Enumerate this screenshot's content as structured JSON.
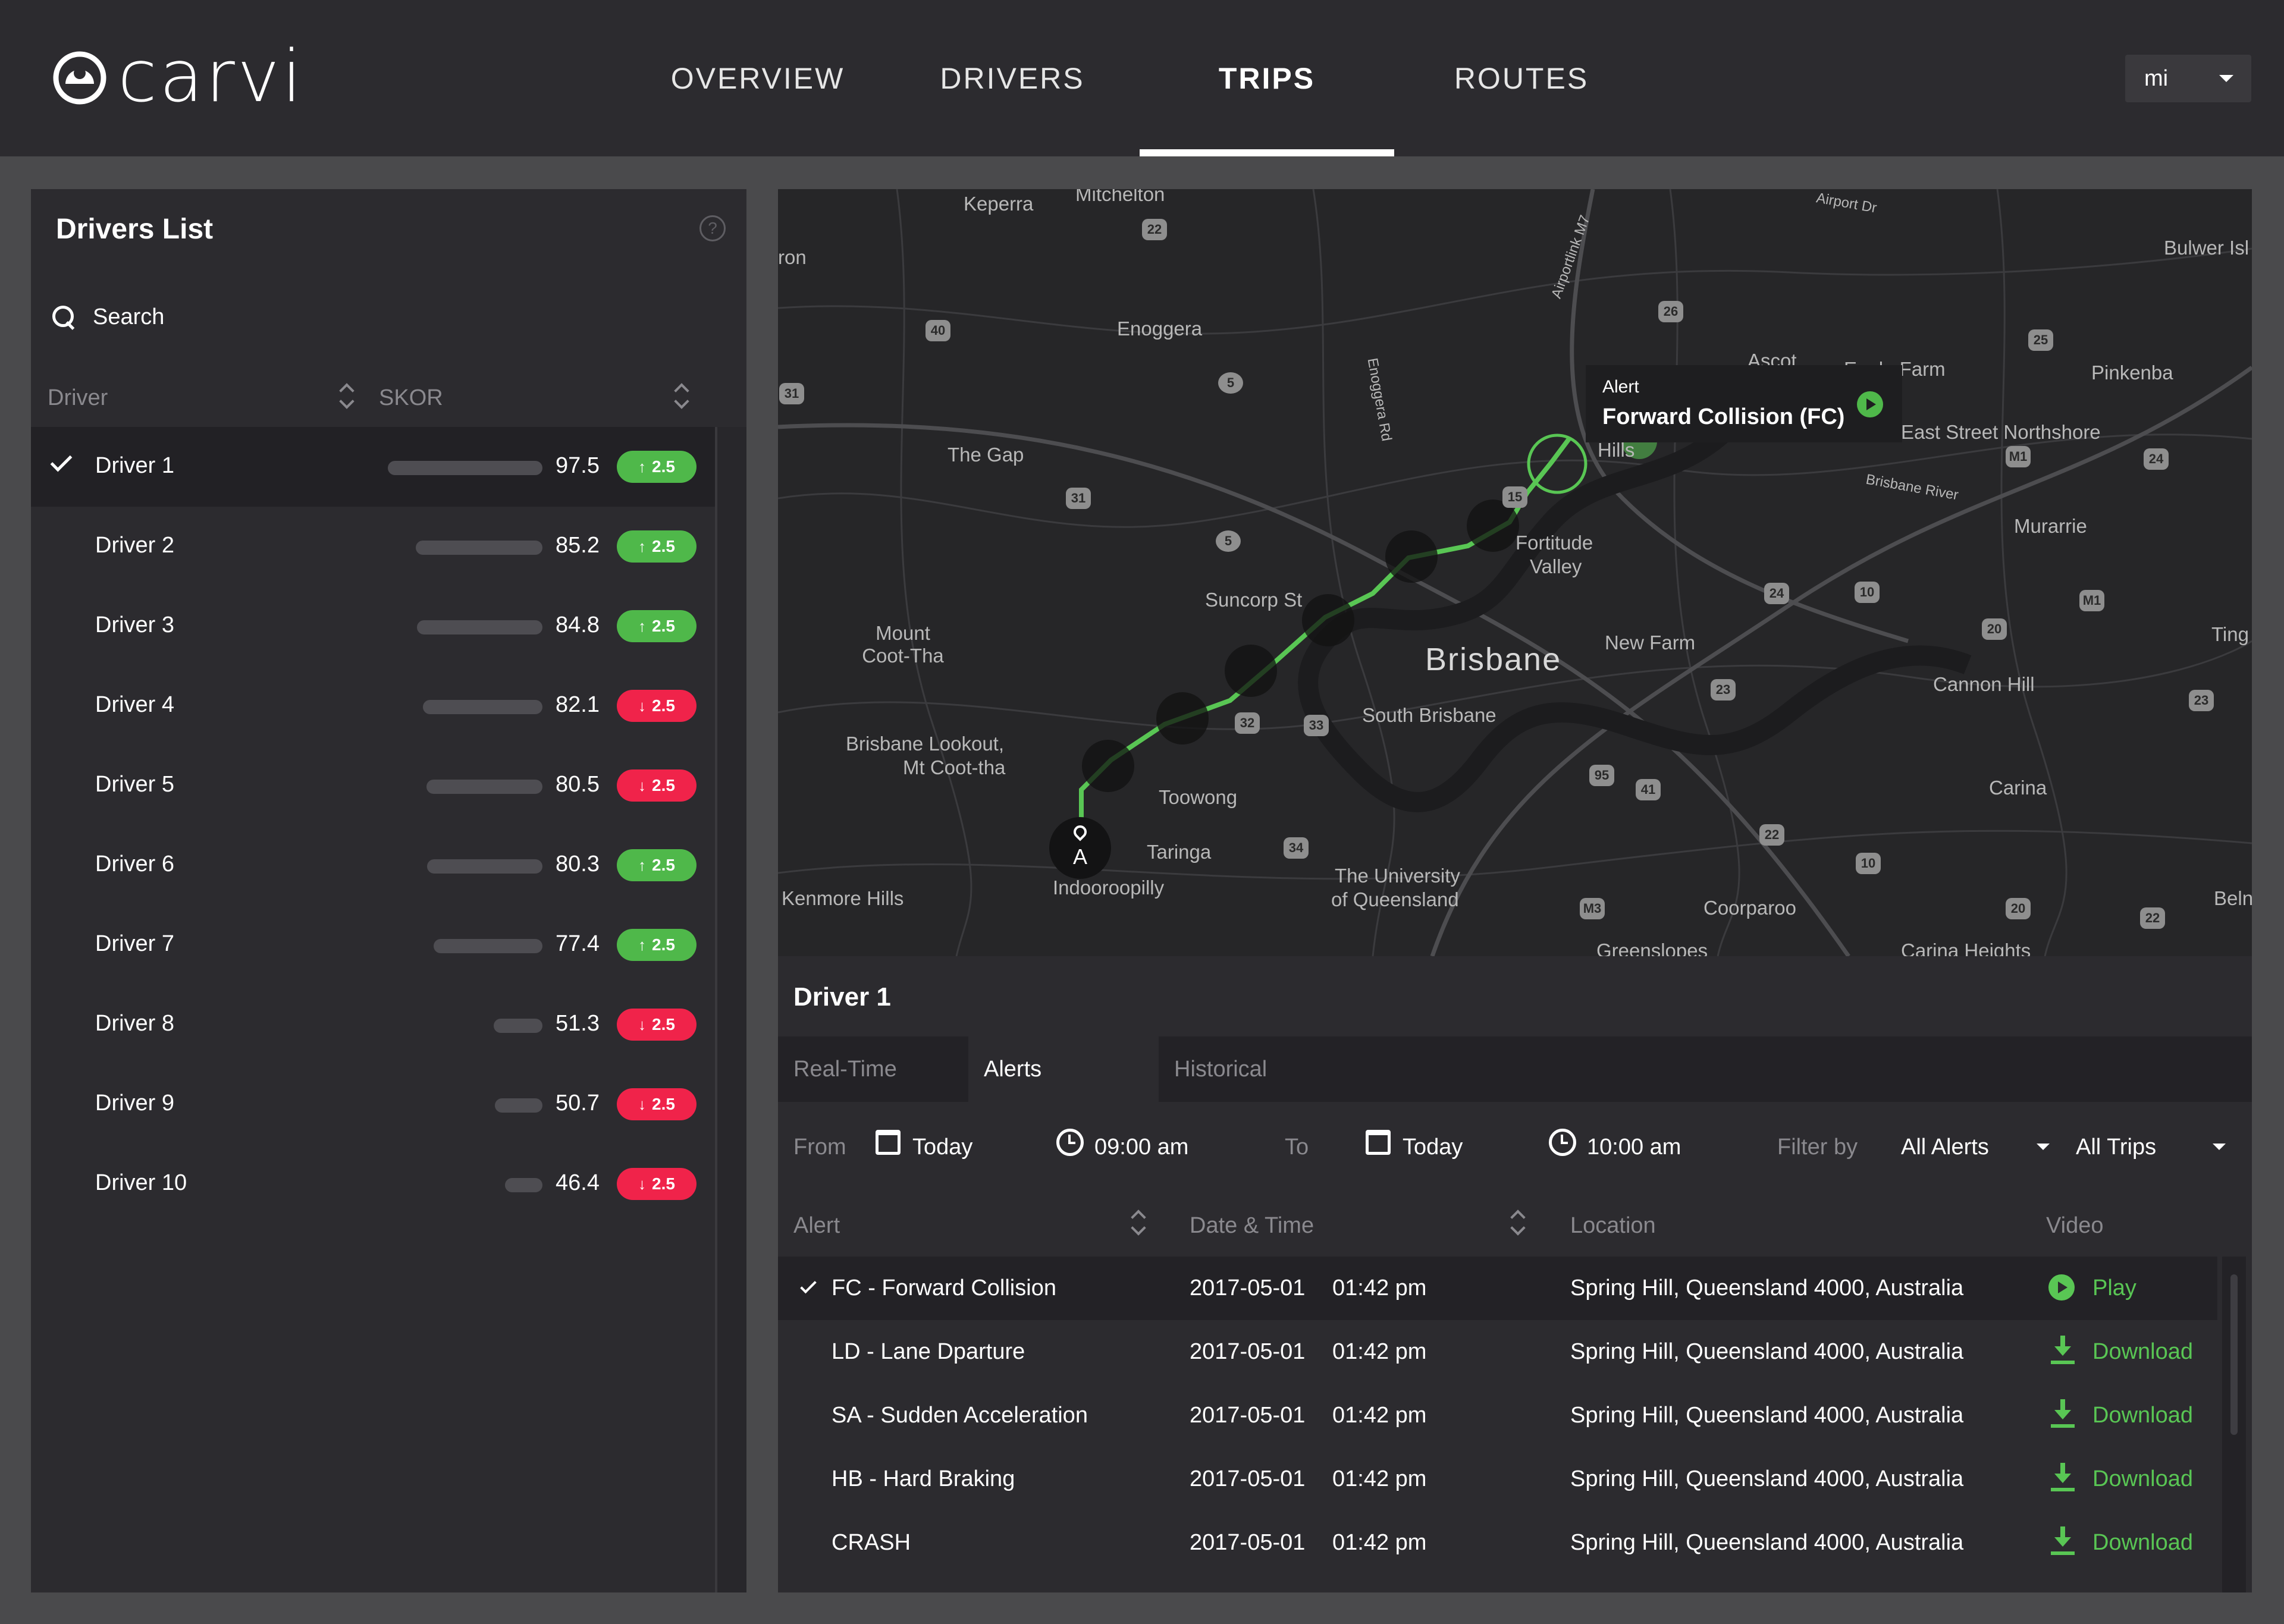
{
  "app": {
    "brand": "carvi",
    "nav": [
      {
        "label": "OVERVIEW",
        "active": false
      },
      {
        "label": "DRIVERS",
        "active": false
      },
      {
        "label": "TRIPS",
        "active": true
      },
      {
        "label": "ROUTES",
        "active": false
      }
    ],
    "user": {
      "label": "mi"
    }
  },
  "drivers_panel": {
    "title": "Drivers List",
    "help_icon": "?",
    "search_label": "Search",
    "columns": {
      "driver": "Driver",
      "skor": "SKOR"
    },
    "drivers": [
      {
        "name": "Driver 1",
        "score": "97.5",
        "delta": "2.5",
        "trend": "up",
        "bar": 0.975,
        "selected": true
      },
      {
        "name": "Driver 2",
        "score": "85.2",
        "delta": "2.5",
        "trend": "up",
        "bar": 0.852,
        "selected": false
      },
      {
        "name": "Driver 3",
        "score": "84.8",
        "delta": "2.5",
        "trend": "up",
        "bar": 0.848,
        "selected": false
      },
      {
        "name": "Driver 4",
        "score": "82.1",
        "delta": "2.5",
        "trend": "down",
        "bar": 0.821,
        "selected": false
      },
      {
        "name": "Driver 5",
        "score": "80.5",
        "delta": "2.5",
        "trend": "down",
        "bar": 0.805,
        "selected": false
      },
      {
        "name": "Driver 6",
        "score": "80.3",
        "delta": "2.5",
        "trend": "up",
        "bar": 0.803,
        "selected": false
      },
      {
        "name": "Driver 7",
        "score": "77.4",
        "delta": "2.5",
        "trend": "up",
        "bar": 0.774,
        "selected": false
      },
      {
        "name": "Driver 8",
        "score": "51.3",
        "delta": "2.5",
        "trend": "down",
        "bar": 0.513,
        "selected": false
      },
      {
        "name": "Driver 9",
        "score": "50.7",
        "delta": "2.5",
        "trend": "down",
        "bar": 0.507,
        "selected": false
      },
      {
        "name": "Driver 10",
        "score": "46.4",
        "delta": "2.5",
        "trend": "down",
        "bar": 0.464,
        "selected": false
      }
    ]
  },
  "map": {
    "labels": [
      "Keperra",
      "Mitchelton",
      "Enoggera",
      "The Gap",
      "Suncorp St",
      "Mount Coot-Tha",
      "Brisbane Lookout,",
      "Mt Coot-tha",
      "Toowong",
      "Taringa",
      "Indooroopilly",
      "Kenmore Hills",
      "The University",
      "of Queensland",
      "Brisbane",
      "South Brisbane",
      "Fortitude",
      "Valley",
      "Hills",
      "New Farm",
      "Ascot",
      "Eagle Farm",
      "Pinkenba",
      "Bulwer Isl",
      "Murarrie",
      "Cannon Hill",
      "Carina",
      "Coorparoo",
      "Greenslopes",
      "Carina Heights",
      "Ting",
      "Beln",
      "ron",
      "Airport Dr",
      "Airportlink M7",
      "Enoggera Rd",
      "Brisbane River",
      "East Street Northshore"
    ],
    "shields": [
      "22",
      "40",
      "31",
      "26",
      "25",
      "15",
      "5",
      "5",
      "32",
      "33",
      "34",
      "41",
      "95",
      "22",
      "10",
      "10",
      "24",
      "20",
      "23",
      "23",
      "24",
      "M1",
      "M1",
      "M3",
      "20",
      "22",
      "31",
      "5"
    ],
    "alert_popup": {
      "kicker": "Alert",
      "title": "Forward Collision (FC)"
    },
    "start_pin": "A",
    "route_color": "#59c654"
  },
  "trip_panel": {
    "title": "Driver 1",
    "tabs": [
      {
        "label": "Real-Time",
        "active": false
      },
      {
        "label": "Alerts",
        "active": true
      },
      {
        "label": "Historical",
        "active": false
      }
    ],
    "filters": {
      "from_label": "From",
      "from_date": "Today",
      "from_time": "09:00 am",
      "to_label": "To",
      "to_date": "Today",
      "to_time": "10:00 am",
      "filter_label": "Filter by",
      "alert_filter": "All Alerts",
      "trip_filter": "All Trips"
    },
    "columns": {
      "alert": "Alert",
      "datetime": "Date & Time",
      "location": "Location",
      "video": "Video"
    },
    "alerts": [
      {
        "alert": "FC - Forward Collision",
        "date": "2017-05-01",
        "time": "01:42 pm",
        "location": "Spring Hill, Queensland 4000, Australia",
        "video": "Play",
        "video_type": "play",
        "selected": true
      },
      {
        "alert": "LD - Lane Dparture",
        "date": "2017-05-01",
        "time": "01:42 pm",
        "location": "Spring Hill, Queensland 4000, Australia",
        "video": "Download",
        "video_type": "download",
        "selected": false
      },
      {
        "alert": "SA - Sudden Acceleration",
        "date": "2017-05-01",
        "time": "01:42 pm",
        "location": "Spring Hill, Queensland 4000, Australia",
        "video": "Download",
        "video_type": "download",
        "selected": false
      },
      {
        "alert": "HB - Hard Braking",
        "date": "2017-05-01",
        "time": "01:42 pm",
        "location": "Spring Hill, Queensland 4000, Australia",
        "video": "Download",
        "video_type": "download",
        "selected": false
      },
      {
        "alert": "CRASH",
        "date": "2017-05-01",
        "time": "01:42 pm",
        "location": "Spring Hill, Queensland 4000, Australia",
        "video": "Download",
        "video_type": "download",
        "selected": false
      }
    ]
  },
  "colors": {
    "accent_green": "#59c654",
    "alert_red": "#f0234a",
    "badge_green": "#4fb84a",
    "panel": "#2c2b2f",
    "background": "#4a4a4c"
  }
}
